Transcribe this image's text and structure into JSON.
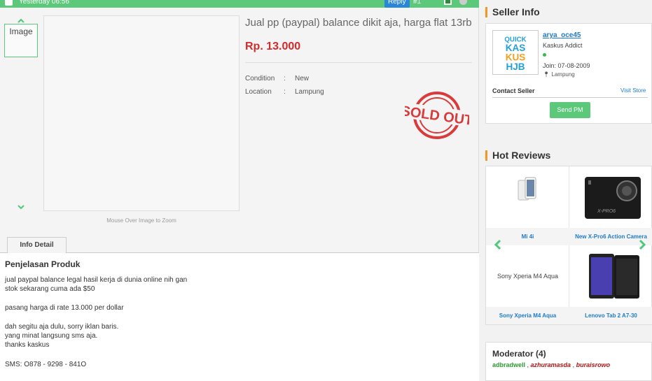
{
  "topbar": {
    "date": "Yesterday 06:56",
    "reply_label": "Reply",
    "post_number": "#1"
  },
  "gallery": {
    "thumb_label": "Image",
    "zoom_note": "Mouse Over Image to Zoom"
  },
  "product": {
    "title": "Jual pp (paypal) balance dikit aja, harga flat 13rb",
    "price": "Rp. 13.000",
    "specs": [
      {
        "key": "Condition",
        "sep": ":",
        "value": "New"
      },
      {
        "key": "Location",
        "sep": ":",
        "value": "Lampung"
      }
    ],
    "sold_out": "SOLD OUT"
  },
  "tabs": {
    "info_detail": "Info Detail"
  },
  "description": {
    "heading": "Penjelasan Produk",
    "lines": [
      "jual paypal balance legal hasil kerja di dunia online nih gan",
      "stok sekarang cuma ada $50",
      "pasang harga di rate 13.000 per dollar",
      "dah segitu aja dulu, sorry iklan baris.",
      "yang minat langsung sms aja.",
      "thanks kaskus",
      "SMS: O878 - 9298 - 841O"
    ]
  },
  "seller": {
    "section_title": "Seller Info",
    "username": "arya_oce45",
    "rank": "Kaskus Addict",
    "join": "Join: 07-08-2009",
    "location": "Lampung",
    "contact_label": "Contact Seller",
    "visit_store": "Visit Store",
    "send_pm": "Send PM",
    "logo_text": [
      "QUICK",
      "KAS",
      "KUS",
      "HJB"
    ]
  },
  "reviews": {
    "section_title": "Hot Reviews",
    "items": [
      {
        "label": "Mi 4i",
        "image_text": ""
      },
      {
        "label": "New X-Pro6 Action Camera",
        "image_text": ""
      },
      {
        "label": "Sony Xperia M4 Aqua",
        "image_text": "Sony Xperia M4 Aqua"
      },
      {
        "label": "Lenovo Tab 2 A7-30",
        "image_text": ""
      }
    ]
  },
  "moderator": {
    "title": "Moderator (4)",
    "names": [
      "adbradwell",
      "azhuramasda",
      "buraisrowo"
    ]
  },
  "colors": {
    "accent_green": "#5cc97a",
    "price_red": "#d32a2a",
    "link_blue": "#1e7bc8",
    "section_orange": "#f29725"
  },
  "icons": [
    "checkbox-icon",
    "chevron-up-icon",
    "chevron-down-icon",
    "sold-out-stamp-icon",
    "map-pin-icon",
    "chevron-left-icon",
    "chevron-right-icon",
    "online-dot-icon"
  ]
}
